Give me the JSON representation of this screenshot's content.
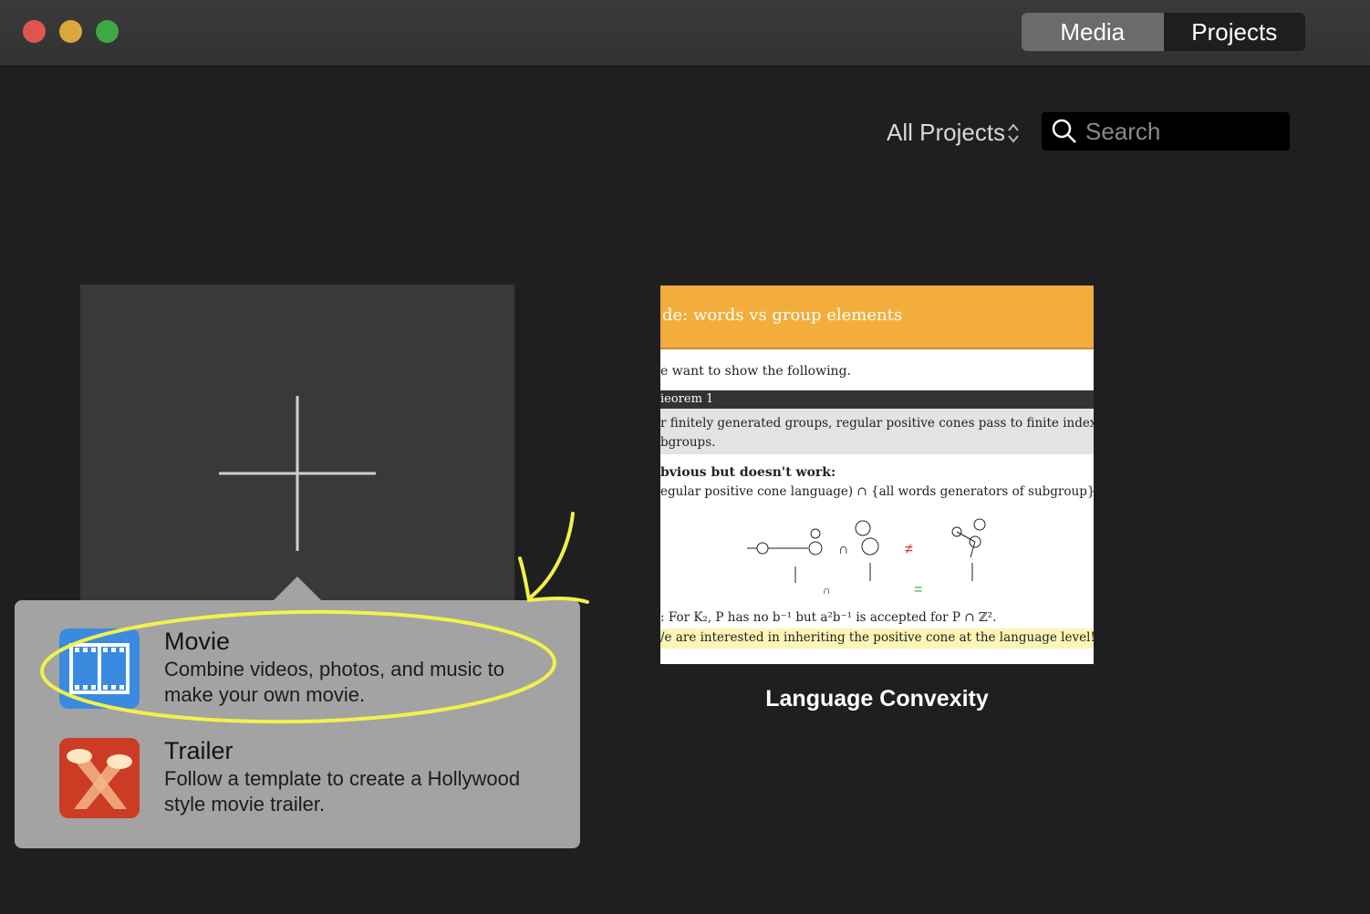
{
  "window": {
    "traffic_lights": {
      "close": "#e0564f",
      "minimize": "#d9a73c",
      "zoom": "#3fa844"
    }
  },
  "toolbar": {
    "tabs": [
      {
        "label": "Media",
        "selected": true
      },
      {
        "label": "Projects",
        "selected": false
      }
    ]
  },
  "browser": {
    "filter_label": "All Projects",
    "search_placeholder": "Search"
  },
  "new_project": {
    "icon": "plus-icon",
    "options": [
      {
        "title": "Movie",
        "description": "Combine videos, photos, and music to make your own movie.",
        "icon": "film-strip-icon",
        "icon_color": "#3a8be0"
      },
      {
        "title": "Trailer",
        "description": "Follow a template to create a Hollywood style movie trailer.",
        "icon": "spotlight-icon",
        "icon_color": "#cc3b24"
      }
    ]
  },
  "projects": [
    {
      "name": "Language Convexity",
      "thumbnail": {
        "heading": "de:  words vs group elements",
        "intro": "e want to show the following.",
        "theorem_label": "ieorem 1",
        "theorem_text_1": "r finitely generated groups, regular positive cones pass to finite index",
        "theorem_text_2": "bgroups.",
        "obvious": "bvious but doesn't work:",
        "formula": "egular positive cone language) ∩ {all words generators of subgroup}",
        "example": ": For K₂, P has no b⁻¹ but a²b⁻¹ is accepted for P ∩ ℤ².",
        "highlight": "/e are interested in inheriting the positive cone at the language level!",
        "accent_color": "#f2ad3c"
      }
    }
  ],
  "annotations": {
    "highlight_color": "#f3f14a"
  }
}
